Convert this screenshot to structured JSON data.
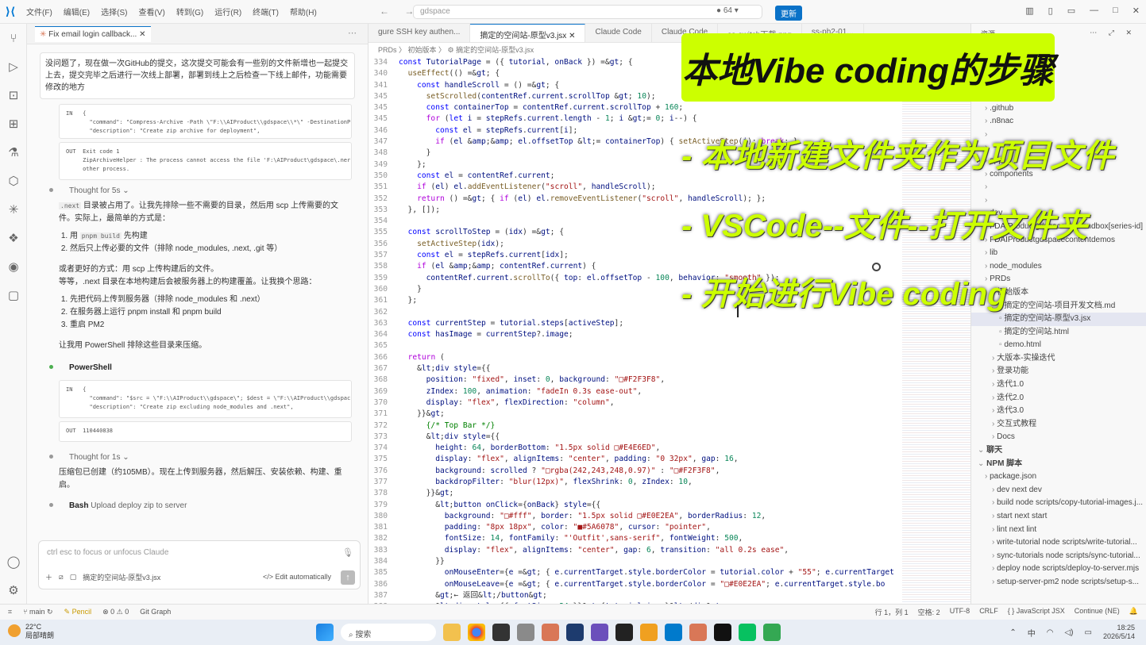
{
  "menu": [
    "文件(F)",
    "编辑(E)",
    "选择(S)",
    "查看(V)",
    "转到(G)",
    "运行(R)",
    "终端(T)",
    "帮助(H)"
  ],
  "search_placeholder": "gdspace",
  "copilot_count": "64",
  "update_button": "更新",
  "chat": {
    "tab": "Fix email login callback...",
    "user_message": "没问题了，现在做一次GitHub的提交，这次提交可能会有一些别的文件新增也一起提交上去，提交完毕之后进行一次线上部署，部署到线上之后检查一下线上邮件，功能需要修改的地方",
    "tool1_in": "IN   {\n       \"command\": \"Compress-Archive -Path \\\"F:\\\\AIProduct\\\\gdspace\\\\*\\\" -DestinationP\n       \"description\": \"Create zip archive for deployment\",",
    "tool1_out": "OUT  Exit code 1\n     ZipArchiveHelper : The process cannot access the file 'F:\\AIProduct\\gdspace\\.ner\n     other process.",
    "thought1": "Thought for 5s",
    "para1_code": ".next",
    "para1": "目录被占用了。让我先排除一些不需要的目录，然后用 scp 上传需要的文件。实际上，最简单的方式是：",
    "list1_a_pre": "用",
    "list1_a_code": "pnpm build",
    "list1_a_post": "先构建",
    "list1_b": "然后只上传必要的文件（排除 node_modules, .next, .git 等）",
    "para2": "或者更好的方式：用 scp 上传构建后的文件。",
    "para3": "等等，.next 目录在本地构建后会被服务器上的构建覆盖。让我换个思路：",
    "list2": [
      "先把代码上传到服务器（排除 node_modules 和 .next）",
      "在服务器上运行 pnpm install 和 pnpm build",
      "重启 PM2"
    ],
    "para4": "让我用 PowerShell 排除这些目录来压缩。",
    "powershell": "PowerShell",
    "tool2_in": "IN   {\n       \"command\": \"$src = \\\"F:\\\\AIProduct\\\\gdspace\\\"; $dest = \\\"F:\\\\AIProduct\\\\gdspac\n       \"description\": \"Create zip excluding node_modules and .next\",",
    "tool2_out": "OUT  110440838",
    "thought2": "Thought for 1s",
    "para5": "压缩包已创建（约105MB）。现在上传到服务器，然后解压、安装依赖、构建、重启。",
    "bash_label": "Bash",
    "bash_desc": "Upload deploy zip to server",
    "input_placeholder": "ctrl esc to focus or unfocus Claude",
    "input_file": "摘定的空间站-原型v3.jsx",
    "edit_mode": "Edit automatically"
  },
  "editor": {
    "tabs": [
      "gure SSH key authen...",
      "摘定的空间站-原型v3.jsx",
      "Claude Code",
      "Claude Code",
      "ss-switch下载.png",
      "ss-ph2-01..."
    ],
    "breadcrumb": "PRDs  〉 初始版本  〉 ⚙ 摘定的空间站-原型v3.jsx",
    "lines": [
      [
        "334",
        "const TutorialPage = ({ tutorial, onBack }) => {"
      ],
      [
        "340",
        "  useEffect(() => {"
      ],
      [
        "341",
        "    const handleScroll = () => {"
      ],
      [
        "345",
        "      setScrolled(contentRef.current.scrollTop > 10);"
      ],
      [
        "345",
        "      const containerTop = contentRef.current.scrollTop + 160;"
      ],
      [
        "345",
        "      for (let i = stepRefs.current.length - 1; i >= 0; i--) {"
      ],
      [
        "346",
        "        const el = stepRefs.current[i];"
      ],
      [
        "347",
        "        if (el && el.offsetTop <= containerTop) { setActiveStep(i); break; }"
      ],
      [
        "348",
        "      }"
      ],
      [
        "349",
        "    };"
      ],
      [
        "350",
        "    const el = contentRef.current;"
      ],
      [
        "351",
        "    if (el) el.addEventListener(\"scroll\", handleScroll);"
      ],
      [
        "352",
        "    return () => { if (el) el.removeEventListener(\"scroll\", handleScroll); };"
      ],
      [
        "353",
        "  }, []);"
      ],
      [
        "354",
        ""
      ],
      [
        "355",
        "  const scrollToStep = (idx) => {"
      ],
      [
        "356",
        "    setActiveStep(idx);"
      ],
      [
        "357",
        "    const el = stepRefs.current[idx];"
      ],
      [
        "358",
        "    if (el && contentRef.current) {"
      ],
      [
        "359",
        "      contentRef.current.scrollTo({ top: el.offsetTop - 100, behavior: \"smooth\" });"
      ],
      [
        "360",
        "    }"
      ],
      [
        "361",
        "  };"
      ],
      [
        "362",
        ""
      ],
      [
        "363",
        "  const currentStep = tutorial.steps[activeStep];"
      ],
      [
        "364",
        "  const hasImage = currentStep?.image;"
      ],
      [
        "365",
        ""
      ],
      [
        "366",
        "  return ("
      ],
      [
        "367",
        "    <div style={{"
      ],
      [
        "368",
        "      position: \"fixed\", inset: 0, background: \"□#F2F3F8\","
      ],
      [
        "369",
        "      zIndex: 100, animation: \"fadeIn 0.3s ease-out\","
      ],
      [
        "370",
        "      display: \"flex\", flexDirection: \"column\","
      ],
      [
        "371",
        "    }}>"
      ],
      [
        "372",
        "      {/* Top Bar */}"
      ],
      [
        "373",
        "      <div style={{"
      ],
      [
        "374",
        "        height: 64, borderBottom: \"1.5px solid □#E4E6ED\","
      ],
      [
        "375",
        "        display: \"flex\", alignItems: \"center\", padding: \"0 32px\", gap: 16,"
      ],
      [
        "376",
        "        background: scrolled ? \"□rgba(242,243,248,0.97)\" : \"□#F2F3F8\","
      ],
      [
        "377",
        "        backdropFilter: \"blur(12px)\", flexShrink: 0, zIndex: 10,"
      ],
      [
        "378",
        "      }}>"
      ],
      [
        "379",
        "        <button onClick={onBack} style={{"
      ],
      [
        "380",
        "          background: \"□#fff\", border: \"1.5px solid □#E0E2EA\", borderRadius: 12,"
      ],
      [
        "381",
        "          padding: \"8px 18px\", color: \"■#5A6078\", cursor: \"pointer\","
      ],
      [
        "382",
        "          fontSize: 14, fontFamily: \"'Outfit',sans-serif\", fontWeight: 500,"
      ],
      [
        "383",
        "          display: \"flex\", alignItems: \"center\", gap: 6, transition: \"all 0.2s ease\","
      ],
      [
        "384",
        "        }}"
      ],
      [
        "385",
        "          onMouseEnter={e => { e.currentTarget.style.borderColor = tutorial.color + \"55\"; e.currentTarget"
      ],
      [
        "386",
        "          onMouseLeave={e => { e.currentTarget.style.borderColor = \"□#E0E2EA\"; e.currentTarget.style.bo"
      ],
      [
        "387",
        "        >← 返回</button>"
      ],
      [
        "388",
        "        <div style={{ fontSize: 24 }}>{tutorial.icon}</div>"
      ]
    ]
  },
  "explorer": {
    "header": "资源...",
    "items": [
      {
        "t": ".claude",
        "d": 1
      },
      {
        "t": ".github",
        "d": 1
      },
      {
        "t": ".n8nac",
        "d": 1
      },
      {
        "t": "",
        "d": 1
      },
      {
        "t": "",
        "d": 1
      },
      {
        "t": "app",
        "d": 1
      },
      {
        "t": "components",
        "d": 1
      },
      {
        "t": "",
        "d": 1
      },
      {
        "t": "",
        "d": 1
      },
      {
        "t": "dev",
        "d": 1
      },
      {
        "t": "FDAIProductgdspaceappsandbox[series-id]",
        "d": 1
      },
      {
        "t": "FDAIProductgdspacecontentdemos",
        "d": 1
      },
      {
        "t": "lib",
        "d": 1
      },
      {
        "t": "node_modules",
        "d": 1
      },
      {
        "t": "PRDs",
        "d": 1
      },
      {
        "t": "初始版本",
        "d": 2
      },
      {
        "t": "摘定的空间站-项目开发文档.md",
        "d": 3
      },
      {
        "t": "摘定的空间站-原型v3.jsx",
        "d": 3,
        "sel": true
      },
      {
        "t": "摘定的空间站.html",
        "d": 3
      },
      {
        "t": "demo.html",
        "d": 3
      },
      {
        "t": "大版本-实操迭代",
        "d": 2
      },
      {
        "t": "登录功能",
        "d": 2
      },
      {
        "t": "迭代1.0",
        "d": 2
      },
      {
        "t": "迭代2.0",
        "d": 2
      },
      {
        "t": "迭代3.0",
        "d": 2
      },
      {
        "t": "交互式教程",
        "d": 2
      },
      {
        "t": "Docs",
        "d": 2
      },
      {
        "t": "聊天",
        "d": 0
      },
      {
        "t": "NPM 脚本",
        "d": 0
      },
      {
        "t": "package.json",
        "d": 1
      },
      {
        "t": "dev  next dev",
        "d": 2
      },
      {
        "t": "build  node scripts/copy-tutorial-images.j...",
        "d": 2
      },
      {
        "t": "start  next start",
        "d": 2
      },
      {
        "t": "lint  next lint",
        "d": 2
      },
      {
        "t": "write-tutorial  node scripts/write-tutorial...",
        "d": 2
      },
      {
        "t": "sync-tutorials  node scripts/sync-tutorial...",
        "d": 2
      },
      {
        "t": "deploy  node scripts/deploy-to-server.mjs",
        "d": 2
      },
      {
        "t": "setup-server-pm2  node scripts/setup-s...",
        "d": 2
      }
    ]
  },
  "status": {
    "branch": "main",
    "pencil": "Pencil",
    "problems": "⊗ 0 ⚠ 0",
    "git_graph": "Git Graph",
    "position": "行 1，列 1",
    "spaces": "空格: 2",
    "encoding": "UTF-8",
    "eol": "CRLF",
    "language": "{ } JavaScript JSX",
    "continue": "Continue (NE)"
  },
  "taskbar": {
    "temp": "22°C",
    "weather": "局部晴朗",
    "search": "搜索",
    "time": "18:25",
    "date": "2026/5/14",
    "lang": "中"
  },
  "overlay": {
    "title": "本地Vibe coding的步骤",
    "step1": "- 本地新建文件夹作为项目文件",
    "step2": "- VSCode--文件--打开文件夹",
    "step3": "- 开始进行Vibe coding"
  }
}
